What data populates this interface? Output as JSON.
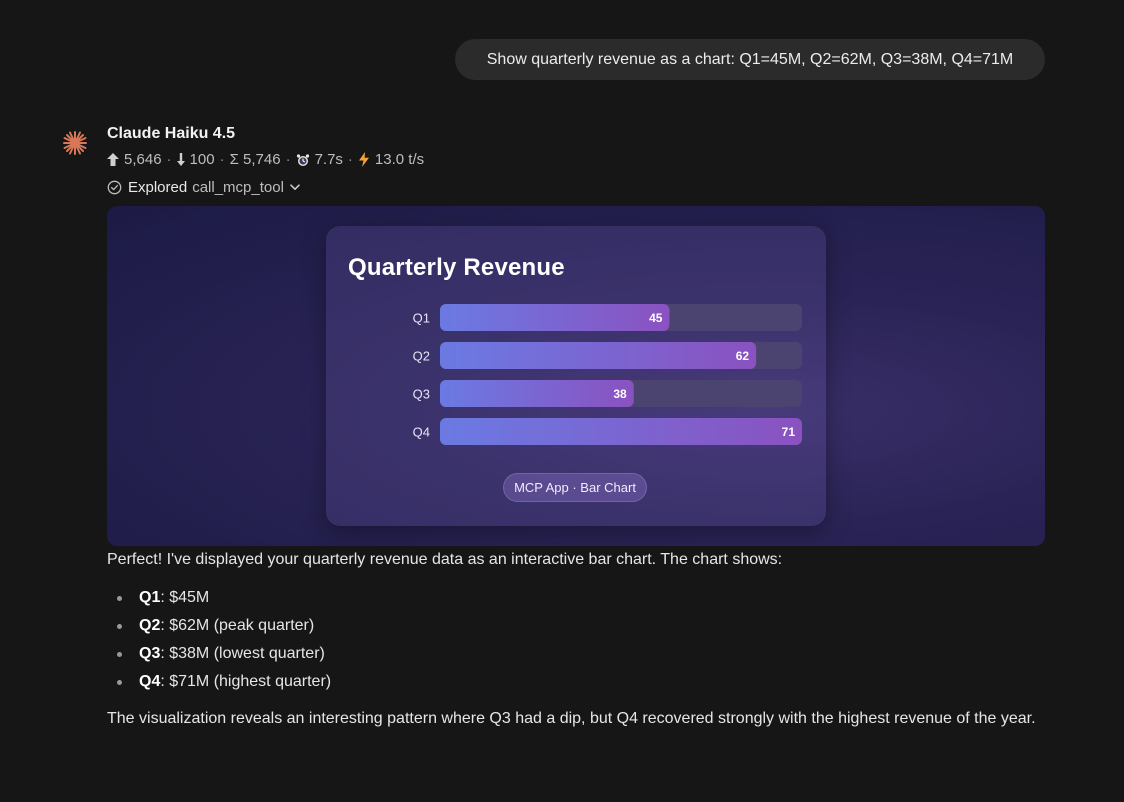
{
  "user_message": "Show quarterly revenue as a chart: Q1=45M, Q2=62M, Q3=38M, Q4=71M",
  "assistant": {
    "model_name": "Claude Haiku 4.5",
    "icon": "claude-starburst-icon",
    "stats": {
      "input_tokens": "5,646",
      "output_tokens": "100",
      "total_tokens": "Σ 5,746",
      "time": "7.7s",
      "speed": "13.0 t/s"
    },
    "explored": {
      "label": "Explored",
      "tool": "call_mcp_tool"
    }
  },
  "app": {
    "footer": "MCP App · Bar Chart"
  },
  "chart_data": {
    "type": "bar",
    "orientation": "horizontal",
    "title": "Quarterly Revenue",
    "categories": [
      "Q1",
      "Q2",
      "Q3",
      "Q4"
    ],
    "values": [
      45,
      62,
      38,
      71
    ],
    "xlim": [
      0,
      71
    ],
    "grid": false,
    "legend": "none"
  },
  "response": {
    "intro": "Perfect! I've displayed your quarterly revenue data as an interactive bar chart. The chart shows:",
    "bullets": [
      {
        "label": "Q1",
        "text": ": $45M"
      },
      {
        "label": "Q2",
        "text": ": $62M (peak quarter)"
      },
      {
        "label": "Q3",
        "text": ": $38M (lowest quarter)"
      },
      {
        "label": "Q4",
        "text": ": $71M (highest quarter)"
      }
    ],
    "outro": "The visualization reveals an interesting pattern where Q3 had a dip, but Q4 recovered strongly with the highest revenue of the year."
  },
  "colors": {
    "bar_start": "#6b7ae3",
    "bar_end": "#8a52c0",
    "track": "#4b4470",
    "background": "#161616"
  }
}
